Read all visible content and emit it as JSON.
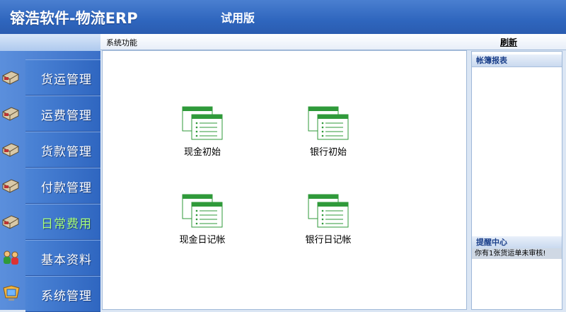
{
  "header": {
    "app_title": "镕浩软件-物流ERP",
    "trial_label": "试用版"
  },
  "subbar": {
    "section_label": "系统功能",
    "refresh_label": "刷新"
  },
  "sidebar": {
    "items": [
      {
        "label": "货运管理",
        "icon": "truck-icon"
      },
      {
        "label": "运费管理",
        "icon": "truck-icon"
      },
      {
        "label": "货款管理",
        "icon": "truck-icon"
      },
      {
        "label": "付款管理",
        "icon": "truck-icon"
      },
      {
        "label": "日常费用",
        "icon": "truck-icon",
        "active": true
      },
      {
        "label": "基本资料",
        "icon": "people-icon"
      },
      {
        "label": "系统管理",
        "icon": "monitor-icon"
      }
    ],
    "active_color": "#a8ff7a"
  },
  "main": {
    "functions": [
      {
        "label": "现金初始",
        "icon": "form-window-icon"
      },
      {
        "label": "银行初始",
        "icon": "form-window-icon"
      },
      {
        "label": "现金日记帐",
        "icon": "form-window-icon"
      },
      {
        "label": "银行日记帐",
        "icon": "form-window-icon"
      }
    ]
  },
  "right_panel": {
    "reports_title": "帐簿报表",
    "reminder_title": "提醒中心",
    "reminder_message": "你有1张货运单未审核!"
  },
  "colors": {
    "header_blue": "#2f66be",
    "icon_green": "#2f9a3a"
  }
}
